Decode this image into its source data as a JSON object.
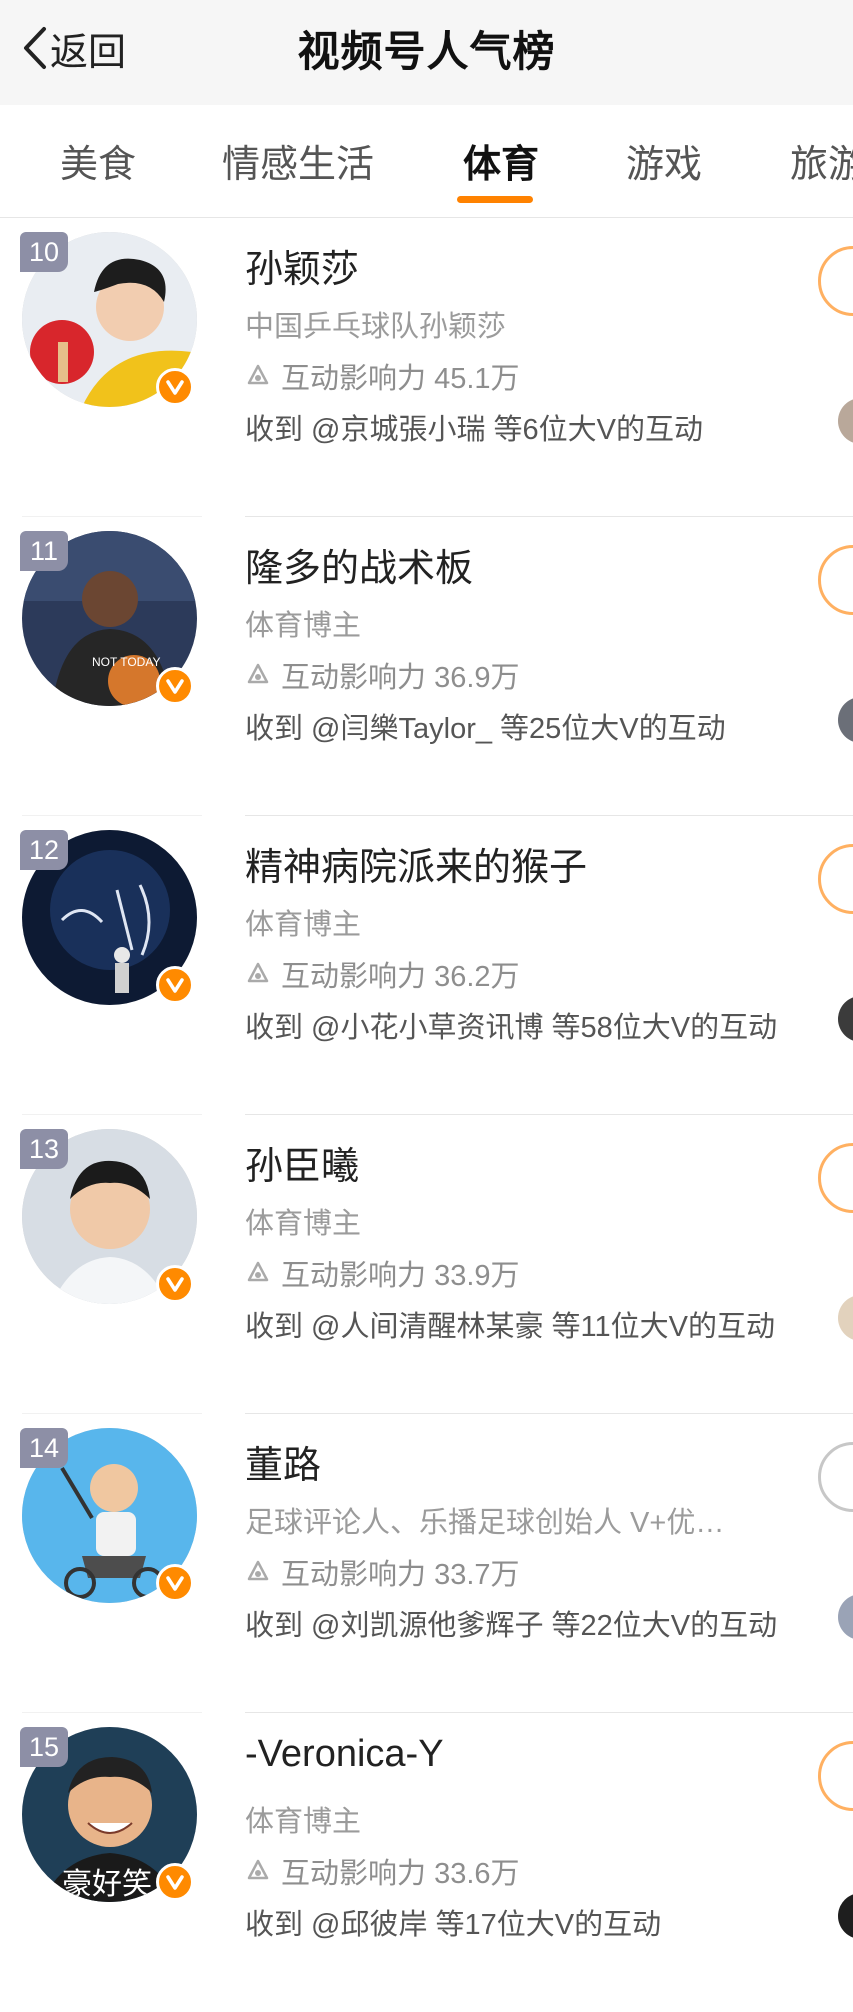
{
  "header": {
    "back_label": "返回",
    "title": "视频号人气榜"
  },
  "tabs": [
    {
      "label": "美食",
      "active": false
    },
    {
      "label": "情感生活",
      "active": false
    },
    {
      "label": "体育",
      "active": true
    },
    {
      "label": "游戏",
      "active": false
    },
    {
      "label": "旅游",
      "active": false
    }
  ],
  "colors": {
    "accent": "#ff8200",
    "rank_badge": "#8d8fa6",
    "verified_badge": "#ff8a00"
  },
  "list": [
    {
      "rank": "10",
      "name": "孙颖莎",
      "desc": "中国乒乓球队孙颖莎",
      "influence_label": "互动影响力",
      "influence_value": "45.1万",
      "interact": "收到 @京城張小瑞 等6位大V的互动"
    },
    {
      "rank": "11",
      "name": "隆多的战术板",
      "desc": "体育博主",
      "influence_label": "互动影响力",
      "influence_value": "36.9万",
      "interact": "收到 @闫樂Taylor_ 等25位大V的互动"
    },
    {
      "rank": "12",
      "name": "精神病院派来的猴子",
      "desc": "体育博主",
      "influence_label": "互动影响力",
      "influence_value": "36.2万",
      "interact": "收到 @小花小草资讯博 等58位大V的互动"
    },
    {
      "rank": "13",
      "name": "孙臣曦",
      "desc": "体育博主",
      "influence_label": "互动影响力",
      "influence_value": "33.9万",
      "interact": "收到 @人间清醒林某豪 等11位大V的互动"
    },
    {
      "rank": "14",
      "name": "董路",
      "desc": "足球评论人、乐播足球创始人 V+优…",
      "influence_label": "互动影响力",
      "influence_value": "33.7万",
      "interact": "收到 @刘凯源他爹辉子 等22位大V的互动"
    },
    {
      "rank": "15",
      "name": "-Veronica-Y",
      "desc": "体育博主",
      "influence_label": "互动影响力",
      "influence_value": "33.6万",
      "interact": "收到 @邱彼岸 等17位大V的互动",
      "avatar_caption": "豪好笑"
    }
  ]
}
